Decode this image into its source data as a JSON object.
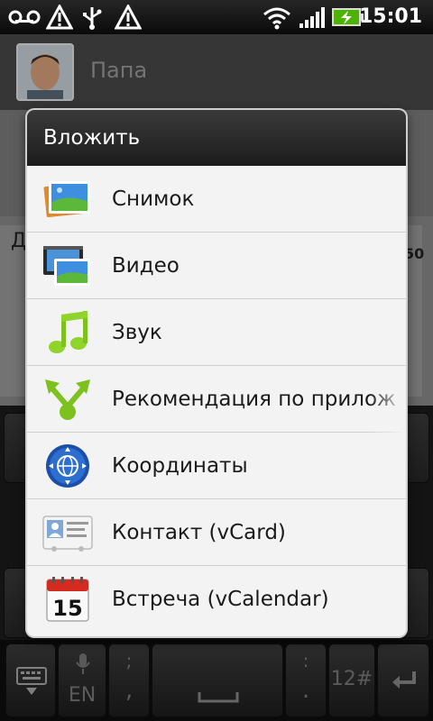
{
  "status_bar": {
    "time": "15:01",
    "icons": [
      "voicemail-icon",
      "warning-icon",
      "usb-icon",
      "warning-icon",
      "wifi-icon",
      "signal-icon",
      "battery-charging-icon"
    ]
  },
  "conversation": {
    "contact_name": "Папа",
    "compose_partial_letter": "Д",
    "counter_partial": "50"
  },
  "dialog": {
    "title": "Вложить",
    "items": [
      {
        "label": "Снимок",
        "icon": "picture-icon"
      },
      {
        "label": "Видео",
        "icon": "video-icon"
      },
      {
        "label": "Звук",
        "icon": "music-note-icon"
      },
      {
        "label": "Рекомендация по прилож",
        "icon": "share-app-icon"
      },
      {
        "label": "Координаты",
        "icon": "location-globe-icon"
      },
      {
        "label": "Контакт (vCard)",
        "icon": "contact-card-icon"
      },
      {
        "label": "Встреча (vCalendar)",
        "icon": "calendar-icon"
      }
    ],
    "calendar_day": "15"
  },
  "keyboard": {
    "lang_label": "EN",
    "comma_label": ",",
    "semicolon_label": ";",
    "period_label": ".",
    "colon_label": ":",
    "numeric_label": "12#"
  }
}
